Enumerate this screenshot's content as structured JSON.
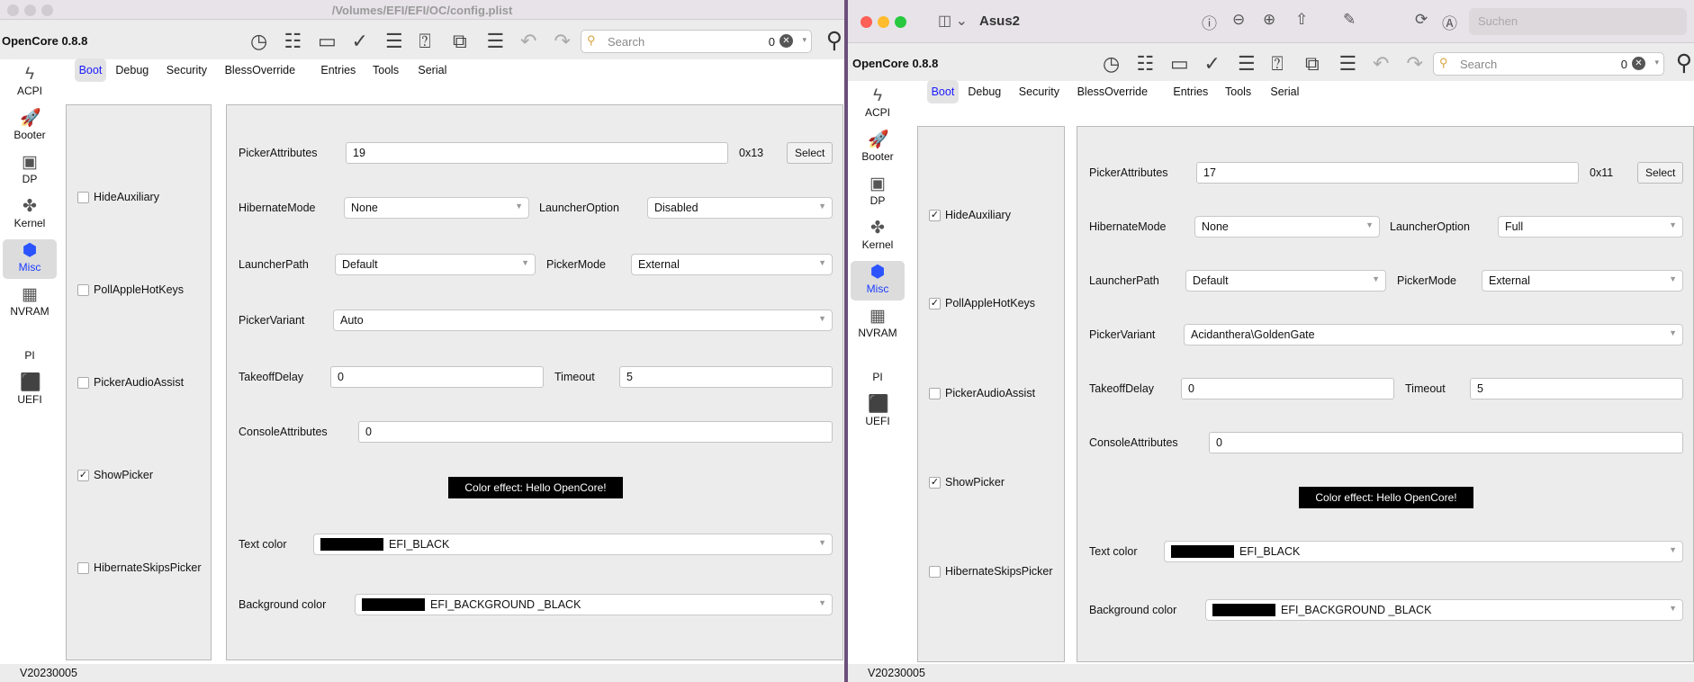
{
  "windows": [
    {
      "title": "/Volumes/EFI/EFI/OC/config.plist",
      "app_label": "OpenCore 0.8.8",
      "search": {
        "placeholder": "Search",
        "count": "0"
      },
      "sidebar": [
        "ACPI",
        "Booter",
        "DP",
        "Kernel",
        "Misc",
        "NVRAM",
        "PI",
        "UEFI"
      ],
      "selected_sidebar": "Misc",
      "tabs": [
        "Boot",
        "Debug",
        "Security",
        "BlessOverride",
        "Entries",
        "Tools",
        "Serial"
      ],
      "selected_tab": "Boot",
      "checkboxes": [
        {
          "label": "HideAuxiliary",
          "checked": false
        },
        {
          "label": "PollAppleHotKeys",
          "checked": false
        },
        {
          "label": "PickerAudioAssist",
          "checked": false
        },
        {
          "label": "ShowPicker",
          "checked": true
        },
        {
          "label": "HibernateSkipsPicker",
          "checked": false
        }
      ],
      "fields": {
        "picker_attributes": {
          "label": "PickerAttributes",
          "value": "19",
          "hex": "0x13",
          "button": "Select"
        },
        "hibernate_mode": {
          "label": "HibernateMode",
          "value": "None"
        },
        "launcher_option": {
          "label": "LauncherOption",
          "value": "Disabled"
        },
        "launcher_path": {
          "label": "LauncherPath",
          "value": "Default"
        },
        "picker_mode": {
          "label": "PickerMode",
          "value": "External"
        },
        "picker_variant": {
          "label": "PickerVariant",
          "value": "Auto"
        },
        "takeoff_delay": {
          "label": "TakeoffDelay",
          "value": "0"
        },
        "timeout": {
          "label": "Timeout",
          "value": "5"
        },
        "console_attributes": {
          "label": "ConsoleAttributes",
          "value": "0"
        },
        "color_effect": "Color effect: Hello OpenCore!",
        "text_color": {
          "label": "Text color",
          "value": "EFI_BLACK",
          "swatch": "#000000"
        },
        "background_color": {
          "label": "Background color",
          "value": "EFI_BACKGROUND _BLACK",
          "swatch": "#000000"
        }
      },
      "status": "V20230005"
    },
    {
      "title": "Asus2",
      "preview_search_placeholder": "Suchen",
      "app_label": "OpenCore 0.8.8",
      "search": {
        "placeholder": "Search",
        "count": "0"
      },
      "sidebar": [
        "ACPI",
        "Booter",
        "DP",
        "Kernel",
        "Misc",
        "NVRAM",
        "PI",
        "UEFI"
      ],
      "selected_sidebar": "Misc",
      "tabs": [
        "Boot",
        "Debug",
        "Security",
        "BlessOverride",
        "Entries",
        "Tools",
        "Serial"
      ],
      "selected_tab": "Boot",
      "checkboxes": [
        {
          "label": "HideAuxiliary",
          "checked": true
        },
        {
          "label": "PollAppleHotKeys",
          "checked": true
        },
        {
          "label": "PickerAudioAssist",
          "checked": false
        },
        {
          "label": "ShowPicker",
          "checked": true
        },
        {
          "label": "HibernateSkipsPicker",
          "checked": false
        }
      ],
      "fields": {
        "picker_attributes": {
          "label": "PickerAttributes",
          "value": "17",
          "hex": "0x11",
          "button": "Select"
        },
        "hibernate_mode": {
          "label": "HibernateMode",
          "value": "None"
        },
        "launcher_option": {
          "label": "LauncherOption",
          "value": "Full"
        },
        "launcher_path": {
          "label": "LauncherPath",
          "value": "Default"
        },
        "picker_mode": {
          "label": "PickerMode",
          "value": "External"
        },
        "picker_variant": {
          "label": "PickerVariant",
          "value": "Acidanthera\\GoldenGate"
        },
        "takeoff_delay": {
          "label": "TakeoffDelay",
          "value": "0"
        },
        "timeout": {
          "label": "Timeout",
          "value": "5"
        },
        "console_attributes": {
          "label": "ConsoleAttributes",
          "value": "0"
        },
        "color_effect": "Color effect: Hello OpenCore!",
        "text_color": {
          "label": "Text color",
          "value": "EFI_BLACK",
          "swatch": "#000000"
        },
        "background_color": {
          "label": "Background color",
          "value": "EFI_BACKGROUND _BLACK",
          "swatch": "#000000"
        }
      },
      "status": "V20230005"
    }
  ]
}
